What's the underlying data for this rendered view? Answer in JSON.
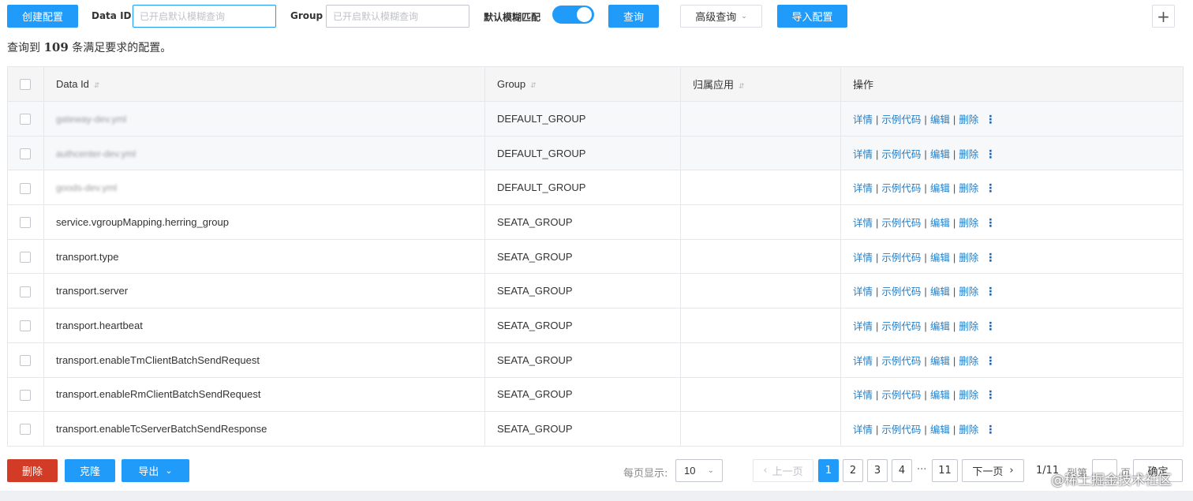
{
  "toolbar": {
    "create_label": "创建配置",
    "data_id_label": "Data ID",
    "data_id_placeholder": "已开启默认模糊查询",
    "group_label": "Group",
    "group_placeholder": "已开启默认模糊查询",
    "fuzzy_label": "默认模糊匹配",
    "fuzzy_enabled": true,
    "search_label": "查询",
    "advanced_label": "高级查询",
    "import_label": "导入配置",
    "add_icon": "plus-icon"
  },
  "summary": {
    "prefix": "查询到",
    "count": "109",
    "suffix": "条满足要求的配置。"
  },
  "table": {
    "headers": [
      "Data Id",
      "Group",
      "归属应用",
      "操作"
    ],
    "rows": [
      {
        "data_id": "gateway-dev.yml",
        "group": "DEFAULT_GROUP",
        "app": "",
        "blurred": true
      },
      {
        "data_id": "authcenter-dev.yml",
        "group": "DEFAULT_GROUP",
        "app": "",
        "blurred": true
      },
      {
        "data_id": "goods-dev.yml",
        "group": "DEFAULT_GROUP",
        "app": "",
        "blurred": true
      },
      {
        "data_id": "service.vgroupMapping.herring_group",
        "group": "SEATA_GROUP",
        "app": "",
        "blurred": false
      },
      {
        "data_id": "transport.type",
        "group": "SEATA_GROUP",
        "app": "",
        "blurred": false
      },
      {
        "data_id": "transport.server",
        "group": "SEATA_GROUP",
        "app": "",
        "blurred": false
      },
      {
        "data_id": "transport.heartbeat",
        "group": "SEATA_GROUP",
        "app": "",
        "blurred": false
      },
      {
        "data_id": "transport.enableTmClientBatchSendRequest",
        "group": "SEATA_GROUP",
        "app": "",
        "blurred": false
      },
      {
        "data_id": "transport.enableRmClientBatchSendRequest",
        "group": "SEATA_GROUP",
        "app": "",
        "blurred": false
      },
      {
        "data_id": "transport.enableTcServerBatchSendResponse",
        "group": "SEATA_GROUP",
        "app": "",
        "blurred": false
      }
    ],
    "ops": {
      "detail": "详情",
      "sample": "示例代码",
      "edit": "编辑",
      "delete": "删除",
      "more_icon": "more-vertical-icon"
    }
  },
  "footer": {
    "delete_label": "删除",
    "clone_label": "克隆",
    "export_label": "导出",
    "page_size_label": "每页显示:",
    "page_size": "10",
    "prev_label": "上一页",
    "next_label": "下一页",
    "pages": [
      "1",
      "2",
      "3",
      "4"
    ],
    "ellipsis": "···",
    "last_page": "11",
    "current_page": "1",
    "page_info": "1/11",
    "goto_label": "到第",
    "page_unit": "页",
    "confirm_label": "确定"
  },
  "watermark": "@稀土掘金技术社区",
  "colors": {
    "primary": "#209bfa",
    "danger": "#d23c26",
    "link": "#1f7fc9"
  }
}
